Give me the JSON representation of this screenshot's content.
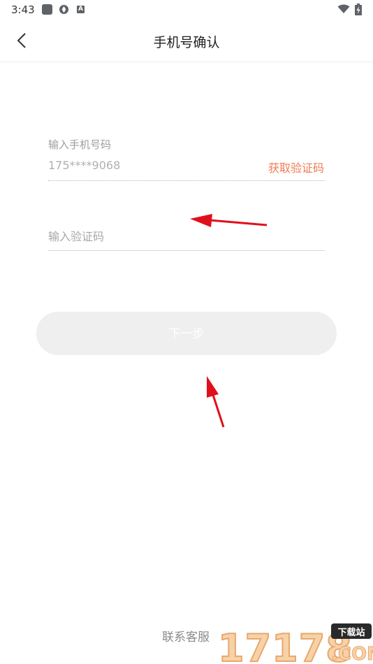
{
  "status_bar": {
    "time": "3:43",
    "icons": [
      "app-square-icon",
      "sync-icon",
      "a-icon",
      "wifi-icon",
      "battery-charging-icon"
    ]
  },
  "header": {
    "back_icon": "chevron-left-icon",
    "title": "手机号确认"
  },
  "form": {
    "phone_label": "输入手机号码",
    "phone_value": "175****9068",
    "get_code_label": "获取验证码",
    "code_placeholder": "输入验证码",
    "next_label": "下一步"
  },
  "footer": {
    "contact_label": "联系客服"
  },
  "watermark": {
    "number_text": "17178",
    "badge_text": "下载站",
    "domain_text": ".COM"
  },
  "colors": {
    "accent": "#f07a55",
    "button_bg": "#efefef",
    "annotation_arrow": "#e0101a"
  }
}
